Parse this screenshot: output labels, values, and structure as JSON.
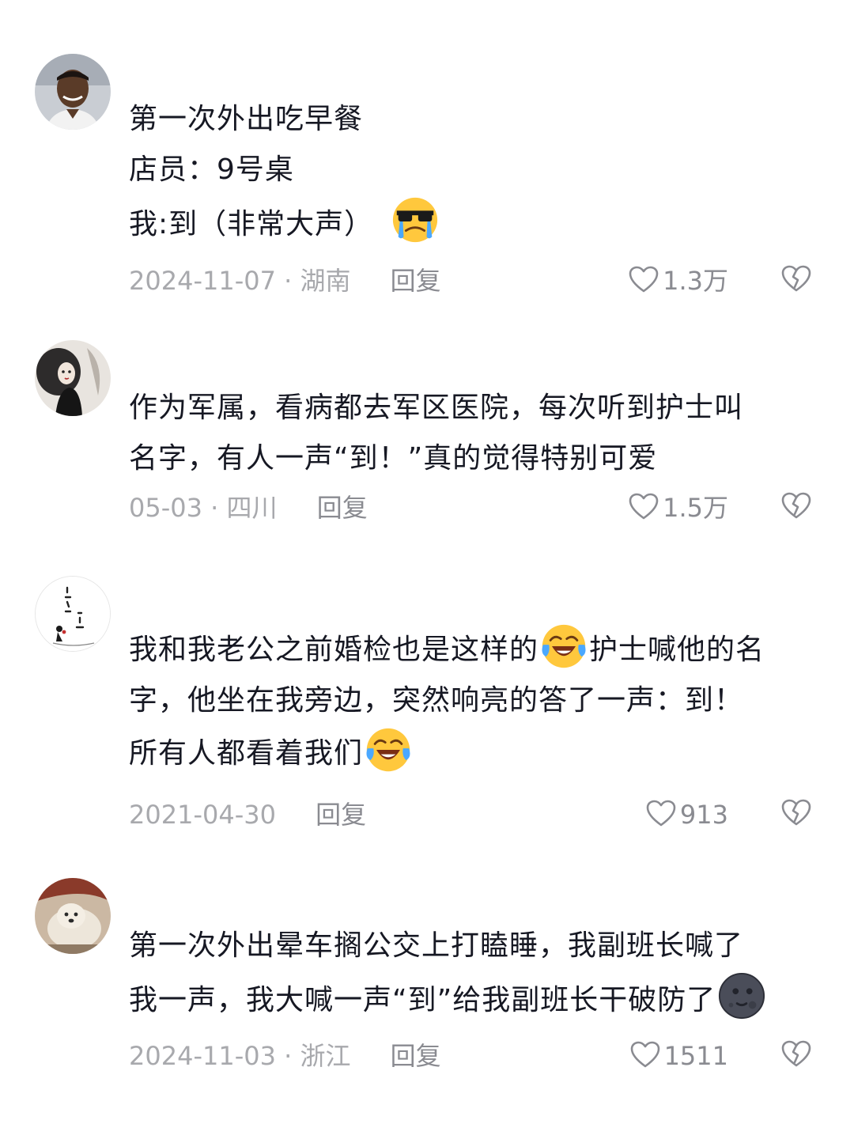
{
  "comments": [
    {
      "avatar_icon": "person-portrait-avatar",
      "lines": [
        "第一次外出吃早餐",
        "店员：9号桌",
        "我:到（非常大声）"
      ],
      "emojis": [
        "sunglasses-crying-emoji"
      ],
      "date": "2024-11-07 · 湖南",
      "reply": "回复",
      "likes": "1.3万"
    },
    {
      "avatar_icon": "woman-illustration-avatar",
      "lines": [
        "作为军属，看病都去军区医院，每次听到护士叫",
        "名字，有人一声“到！”真的觉得特别可爱"
      ],
      "date": "05-03 · 四川",
      "reply": "回复",
      "likes": "1.5万"
    },
    {
      "avatar_icon": "calligraphy-avatar",
      "lines": [
        "我和我老公之前婚检也是这样的",
        "护士喊他的名",
        "字，他坐在我旁边，突然响亮的答了一声：到！",
        "所有人都看着我们"
      ],
      "emojis": [
        "laughing-crying-emoji",
        "laughing-crying-emoji"
      ],
      "date": "2021-04-30",
      "reply": "回复",
      "likes": "913"
    },
    {
      "avatar_icon": "dog-photo-avatar",
      "lines": [
        "第一次外出晕车搁公交上打瞌睡，我副班长喊了",
        "我一声，我大喊一声“到”给我副班长干破防了"
      ],
      "emojis": [
        "dark-moon-face-emoji"
      ],
      "date": "2024-11-03 · 浙江",
      "reply": "回复",
      "likes": "1511"
    }
  ],
  "icons": {
    "like": "heart-outline-icon",
    "dislike": "broken-heart-icon"
  },
  "colors": {
    "text": "#161823",
    "meta": "#a8a9ad",
    "emoji_yellow": "#ffc83d"
  }
}
